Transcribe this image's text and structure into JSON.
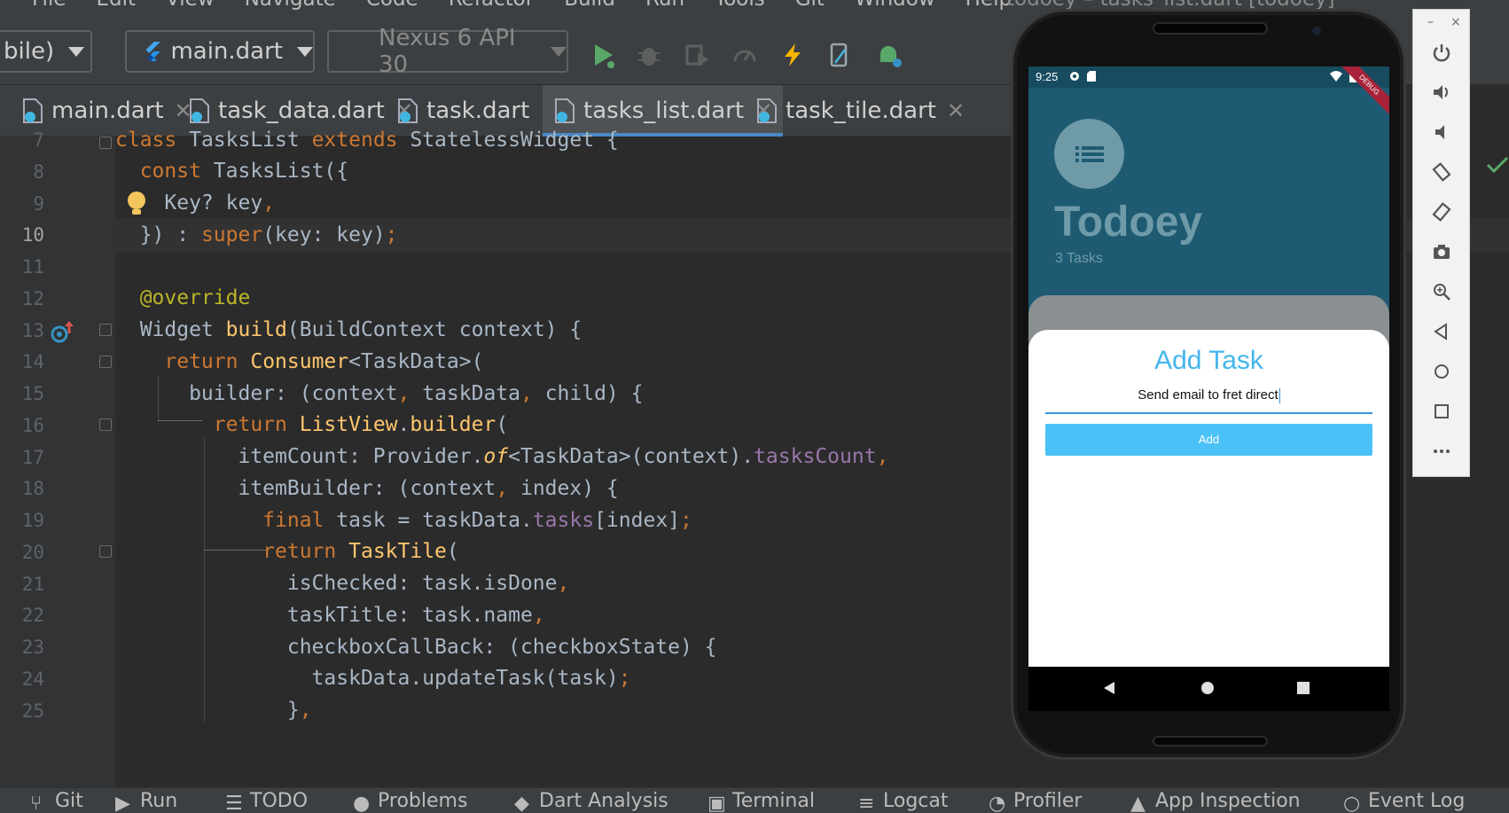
{
  "menu": {
    "items": [
      "File",
      "Edit",
      "View",
      "Navigate",
      "Code",
      "Refactor",
      "Build",
      "Run",
      "Tools",
      "Git",
      "Window",
      "Help"
    ],
    "window_title": "todoey – tasks_list.dart [todoey]"
  },
  "toolbar": {
    "device_combo": "bile)",
    "run_config": "main.dart",
    "device": "Nexus 6 API 30"
  },
  "tabs": [
    {
      "label": "main.dart"
    },
    {
      "label": "task_data.dart"
    },
    {
      "label": "task.dart"
    },
    {
      "label": "tasks_list.dart"
    },
    {
      "label": "task_tile.dart"
    }
  ],
  "editor": {
    "line_numbers": [
      "7",
      "8",
      "9",
      "10",
      "11",
      "12",
      "13",
      "14",
      "15",
      "16",
      "17",
      "18",
      "19",
      "20",
      "21",
      "22",
      "23",
      "24",
      "25"
    ]
  },
  "bottom_tools": [
    {
      "label": "Git"
    },
    {
      "label": "Run"
    },
    {
      "label": "TODO"
    },
    {
      "label": "Problems"
    },
    {
      "label": "Dart Analysis"
    },
    {
      "label": "Terminal"
    },
    {
      "label": "Logcat"
    },
    {
      "label": "Profiler"
    },
    {
      "label": "App Inspection"
    },
    {
      "label": "Event Log"
    }
  ],
  "emulator": {
    "status_time": "9:25",
    "debug_banner": "DEBUG",
    "app_title": "Todoey",
    "task_count": "3 Tasks",
    "sheet_title": "Add Task",
    "input_value": "Send email to fret direct",
    "add_button": "Add"
  },
  "colors": {
    "editor_bg": "#2b2b2b",
    "keyword": "#cc7832",
    "class_name": "#ffc66d",
    "field": "#9876aa",
    "app_primary": "#1e5b73",
    "accent": "#43b6ec",
    "add_button": "#4cc1f7"
  },
  "side_panel": {
    "minimize": "–",
    "close": "×"
  }
}
